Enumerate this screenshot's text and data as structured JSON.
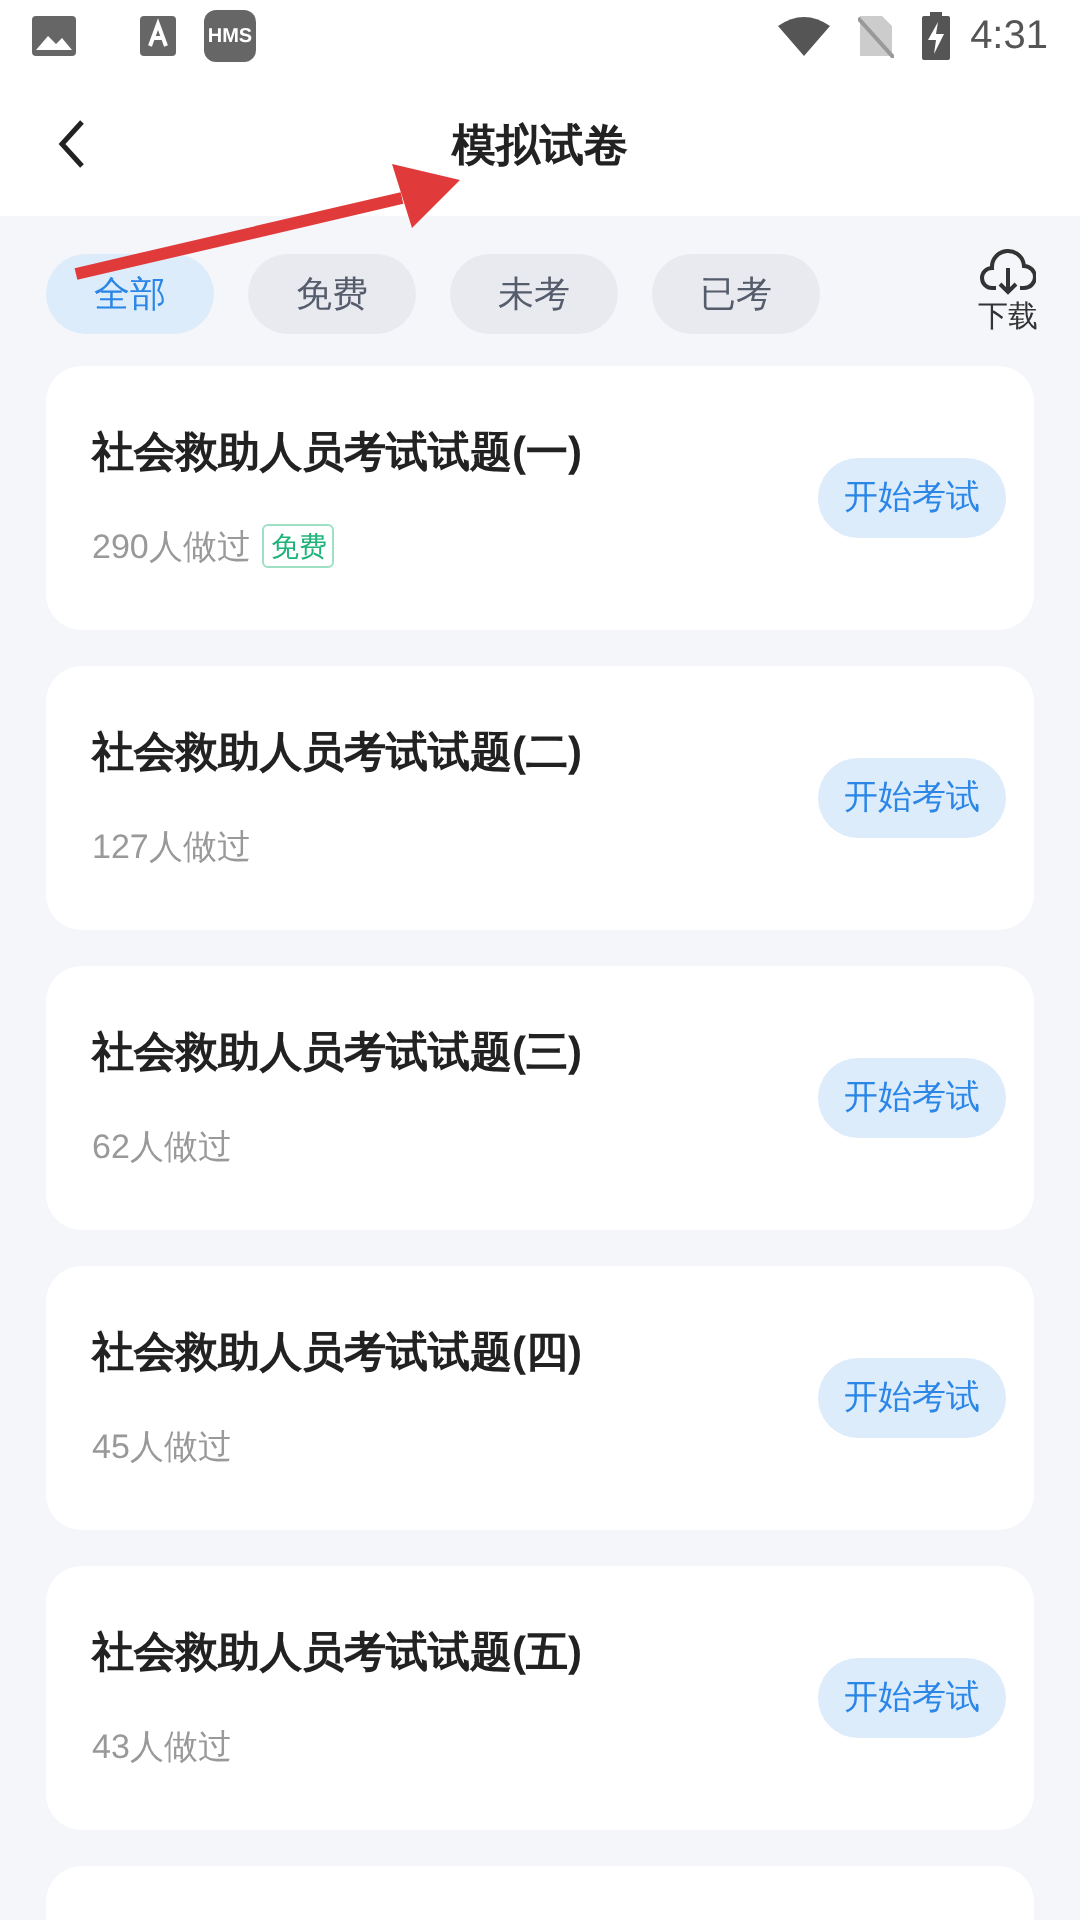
{
  "status_bar": {
    "badge": "HMS",
    "time": "4:31"
  },
  "header": {
    "title": "模拟试卷"
  },
  "filters": [
    {
      "label": "全部",
      "selected": true
    },
    {
      "label": "免费",
      "selected": false
    },
    {
      "label": "未考",
      "selected": false
    },
    {
      "label": "已考",
      "selected": false
    }
  ],
  "download": {
    "label": "下载"
  },
  "exams": [
    {
      "title": "社会救助人员考试试题(一)",
      "taken": "290人做过",
      "tag": "免费",
      "button": "开始考试"
    },
    {
      "title": "社会救助人员考试试题(二)",
      "taken": "127人做过",
      "button": "开始考试"
    },
    {
      "title": "社会救助人员考试试题(三)",
      "taken": "62人做过",
      "button": "开始考试"
    },
    {
      "title": "社会救助人员考试试题(四)",
      "taken": "45人做过",
      "button": "开始考试"
    },
    {
      "title": "社会救助人员考试试题(五)",
      "taken": "43人做过",
      "button": "开始考试"
    }
  ]
}
